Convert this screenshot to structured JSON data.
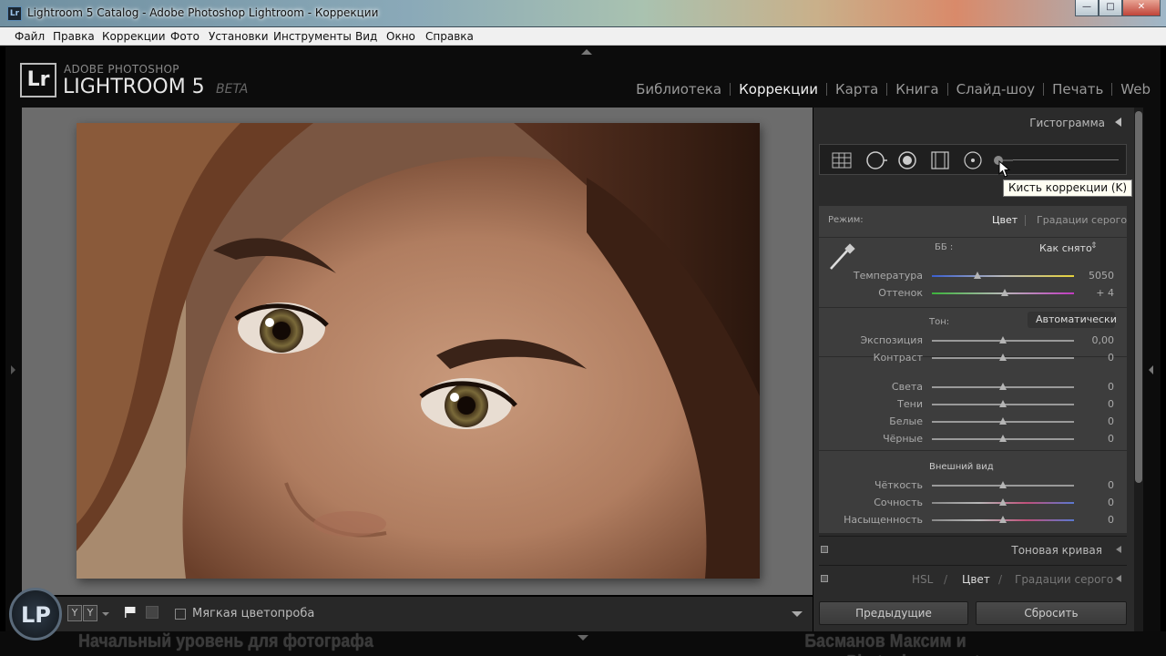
{
  "window": {
    "icon_text": "Lr",
    "title": "Lightroom 5 Catalog - Adobe Photoshop Lightroom - Коррекции",
    "minimize": "—",
    "maximize": "□",
    "close": "✕"
  },
  "menu": [
    "Файл",
    "Правка",
    "Коррекции",
    "Фото",
    "Установки",
    "Инструменты",
    "Вид",
    "Окно",
    "Справка"
  ],
  "brand": {
    "logo": "Lr",
    "top": "ADOBE PHOTOSHOP",
    "main": "LIGHTROOM 5",
    "beta": "BETA"
  },
  "modules": [
    {
      "label": "Библиотека",
      "active": false
    },
    {
      "label": "Коррекции",
      "active": true
    },
    {
      "label": "Карта",
      "active": false
    },
    {
      "label": "Книга",
      "active": false
    },
    {
      "label": "Слайд-шоу",
      "active": false
    },
    {
      "label": "Печать",
      "active": false
    },
    {
      "label": "Web",
      "active": false
    }
  ],
  "toolbar": {
    "yy_left": "Y",
    "yy_right": "Y",
    "soft_proof_label": "Мягкая цветопроба",
    "soft_proof_checked": false
  },
  "right_panel": {
    "histogram_title": "Гистограмма",
    "tools": [
      "crop-overlay",
      "spot-removal",
      "red-eye",
      "graduated-filter",
      "radial-filter",
      "adjustment-brush"
    ],
    "tooltip": "Кисть коррекции (K)",
    "basic": {
      "mode_label": "Режим:",
      "mode_color": "Цвет",
      "mode_gray": "Градации серого",
      "wb_label": "ББ :",
      "wb_value": "Как снято",
      "sliders_wb": [
        {
          "label": "Температура",
          "value": "5050",
          "position": 0.32,
          "track": "temp"
        },
        {
          "label": "Оттенок",
          "value": "+ 4",
          "position": 0.51,
          "track": "tint"
        }
      ],
      "tone_label": "Тон:",
      "auto_label": "Автоматически",
      "sliders_tone": [
        {
          "label": "Экспозиция",
          "value": "0,00",
          "position": 0.5
        },
        {
          "label": "Контраст",
          "value": "0",
          "position": 0.5
        }
      ],
      "sliders_tone2": [
        {
          "label": "Света",
          "value": "0",
          "position": 0.5
        },
        {
          "label": "Тени",
          "value": "0",
          "position": 0.5
        },
        {
          "label": "Белые",
          "value": "0",
          "position": 0.5
        },
        {
          "label": "Чёрные",
          "value": "0",
          "position": 0.5
        }
      ],
      "presence_label": "Внешний вид",
      "sliders_presence": [
        {
          "label": "Чёткость",
          "value": "0",
          "position": 0.5,
          "track": "gray"
        },
        {
          "label": "Сочность",
          "value": "0",
          "position": 0.5,
          "track": "sat"
        },
        {
          "label": "Насыщенность",
          "value": "0",
          "position": 0.5,
          "track": "sat"
        }
      ]
    },
    "tone_curve_title": "Тоновая кривая",
    "hsl_tabs": [
      "HSL",
      "Цвет",
      "Градации серого"
    ],
    "hsl_active": "Цвет",
    "btn_previous": "Предыдущие",
    "btn_reset": "Сбросить"
  },
  "captions": {
    "left": "Начальный уровень для фотографа",
    "right": "Басманов Максим и www.Photoshopsecrets.ru",
    "logo": "LP"
  },
  "colors": {
    "panel_bg": "#2b2b2b",
    "section_bg": "#3d3d3d",
    "center_bg": "#6c6c6c",
    "active_module": "#f2f2f2"
  }
}
